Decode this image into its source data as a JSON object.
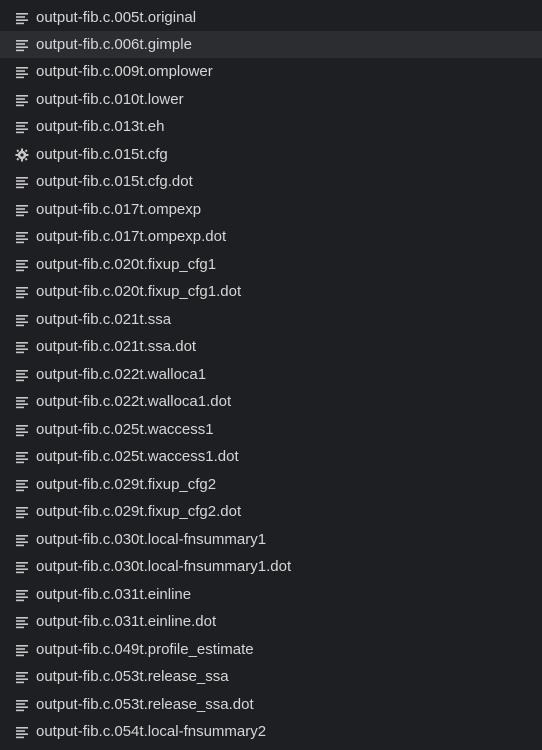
{
  "explorer": {
    "hovered_index": 1,
    "files": [
      {
        "name": "output-fib.c.005t.original",
        "icon": "lines-icon"
      },
      {
        "name": "output-fib.c.006t.gimple",
        "icon": "lines-icon"
      },
      {
        "name": "output-fib.c.009t.omplower",
        "icon": "lines-icon"
      },
      {
        "name": "output-fib.c.010t.lower",
        "icon": "lines-icon"
      },
      {
        "name": "output-fib.c.013t.eh",
        "icon": "lines-icon"
      },
      {
        "name": "output-fib.c.015t.cfg",
        "icon": "gear-icon"
      },
      {
        "name": "output-fib.c.015t.cfg.dot",
        "icon": "lines-icon"
      },
      {
        "name": "output-fib.c.017t.ompexp",
        "icon": "lines-icon"
      },
      {
        "name": "output-fib.c.017t.ompexp.dot",
        "icon": "lines-icon"
      },
      {
        "name": "output-fib.c.020t.fixup_cfg1",
        "icon": "lines-icon"
      },
      {
        "name": "output-fib.c.020t.fixup_cfg1.dot",
        "icon": "lines-icon"
      },
      {
        "name": "output-fib.c.021t.ssa",
        "icon": "lines-icon"
      },
      {
        "name": "output-fib.c.021t.ssa.dot",
        "icon": "lines-icon"
      },
      {
        "name": "output-fib.c.022t.walloca1",
        "icon": "lines-icon"
      },
      {
        "name": "output-fib.c.022t.walloca1.dot",
        "icon": "lines-icon"
      },
      {
        "name": "output-fib.c.025t.waccess1",
        "icon": "lines-icon"
      },
      {
        "name": "output-fib.c.025t.waccess1.dot",
        "icon": "lines-icon"
      },
      {
        "name": "output-fib.c.029t.fixup_cfg2",
        "icon": "lines-icon"
      },
      {
        "name": "output-fib.c.029t.fixup_cfg2.dot",
        "icon": "lines-icon"
      },
      {
        "name": "output-fib.c.030t.local-fnsummary1",
        "icon": "lines-icon"
      },
      {
        "name": "output-fib.c.030t.local-fnsummary1.dot",
        "icon": "lines-icon"
      },
      {
        "name": "output-fib.c.031t.einline",
        "icon": "lines-icon"
      },
      {
        "name": "output-fib.c.031t.einline.dot",
        "icon": "lines-icon"
      },
      {
        "name": "output-fib.c.049t.profile_estimate",
        "icon": "lines-icon"
      },
      {
        "name": "output-fib.c.053t.release_ssa",
        "icon": "lines-icon"
      },
      {
        "name": "output-fib.c.053t.release_ssa.dot",
        "icon": "lines-icon"
      },
      {
        "name": "output-fib.c.054t.local-fnsummary2",
        "icon": "lines-icon"
      }
    ]
  },
  "colors": {
    "background": "#1e1f22",
    "hover": "#2b2d30",
    "text": "#d6d6d6",
    "icon": "#c8c8c8"
  }
}
